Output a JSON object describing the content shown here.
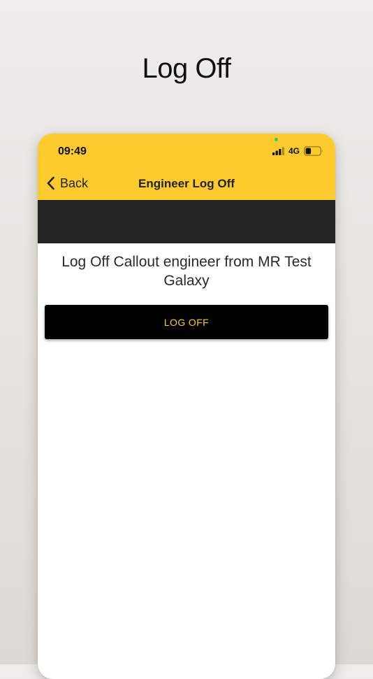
{
  "page": {
    "heading": "Log Off"
  },
  "status_bar": {
    "time": "09:49",
    "network": "4G",
    "signal_icon": "cellular-signal-icon",
    "battery_icon": "battery-icon",
    "privacy_indicator_color": "#34c759"
  },
  "nav_bar": {
    "back_label": "Back",
    "back_icon": "chevron-left-icon",
    "title": "Engineer Log Off"
  },
  "content": {
    "message": "Log Off Callout engineer from MR Test Galaxy",
    "action_button_label": "LOG OFF"
  },
  "colors": {
    "header_yellow": "#fdcb2e",
    "band_dark": "#242424",
    "button_black": "#000000",
    "button_text_yellow": "#fdcb2e"
  }
}
